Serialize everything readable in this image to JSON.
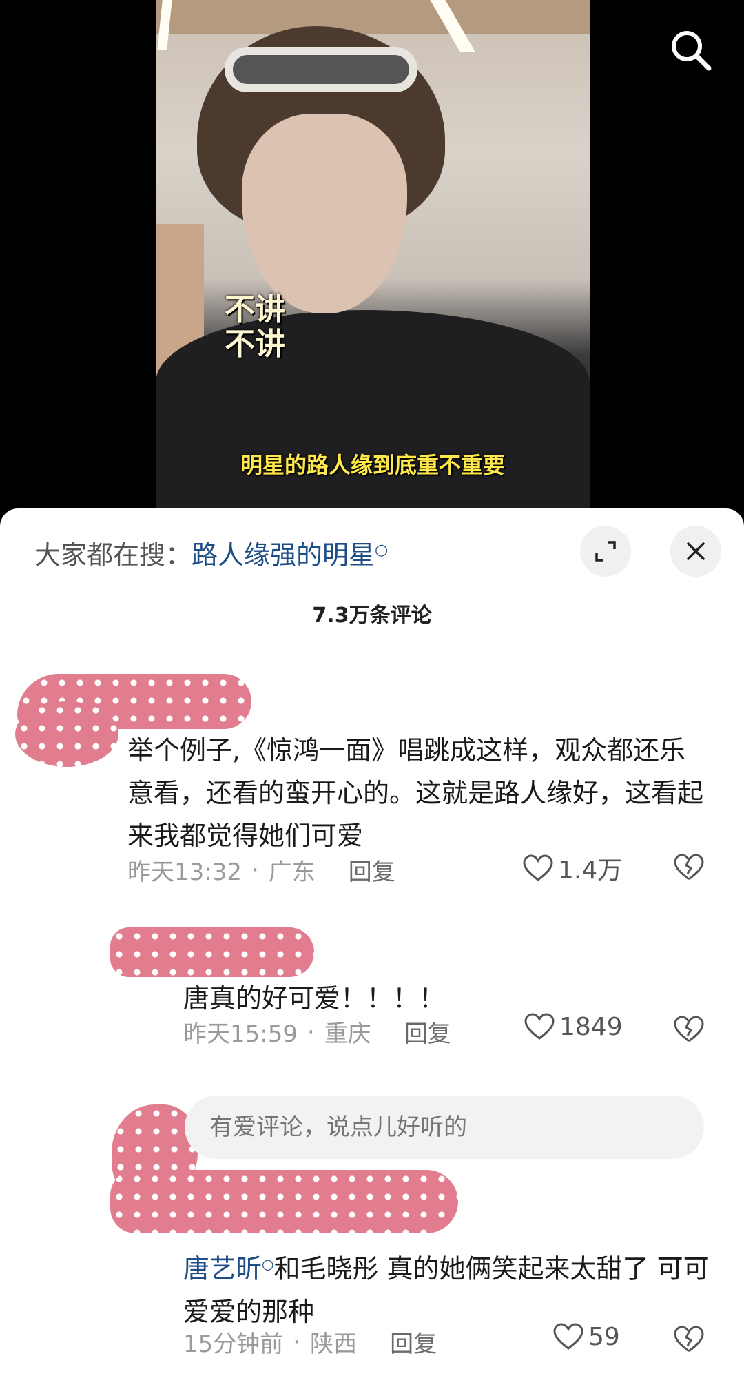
{
  "video": {
    "caption_mid": "不讲\n不讲",
    "caption_bottom": "明星的路人缘到底重不重要"
  },
  "sheet": {
    "search_prefix": "大家都在搜：",
    "search_term": "路人缘强的明星",
    "comment_count": "7.3万条评论",
    "input_placeholder": "有爱评论，说点儿好听的"
  },
  "comments": [
    {
      "text": "举个例子,《惊鸿一面》唱跳成这样，观众都还乐意看，还看的蛮开心的。这就是路人缘好，这看起来我都觉得她们可爱",
      "time": "昨天13:32",
      "location": "广东",
      "reply_label": "回复",
      "likes": "1.4万"
    },
    {
      "text": "唐真的好可爱！！！！",
      "time": "昨天15:59",
      "location": "重庆",
      "reply_label": "回复",
      "likes": "1849"
    },
    {
      "mention": "唐艺昕",
      "text": "和毛晓彤  真的她俩笑起来太甜了  可可爱爱的那种",
      "time": "15分钟前",
      "location": "陕西",
      "reply_label": "回复",
      "likes": "59"
    }
  ],
  "icons": {
    "search": "search-icon",
    "expand": "expand-icon",
    "close": "close-icon",
    "like": "heart-icon",
    "dislike": "broken-heart-icon"
  },
  "colors": {
    "link_blue": "#1f4e86",
    "redaction_pink": "#e27d8f",
    "caption_yellow": "#ffe94a"
  }
}
